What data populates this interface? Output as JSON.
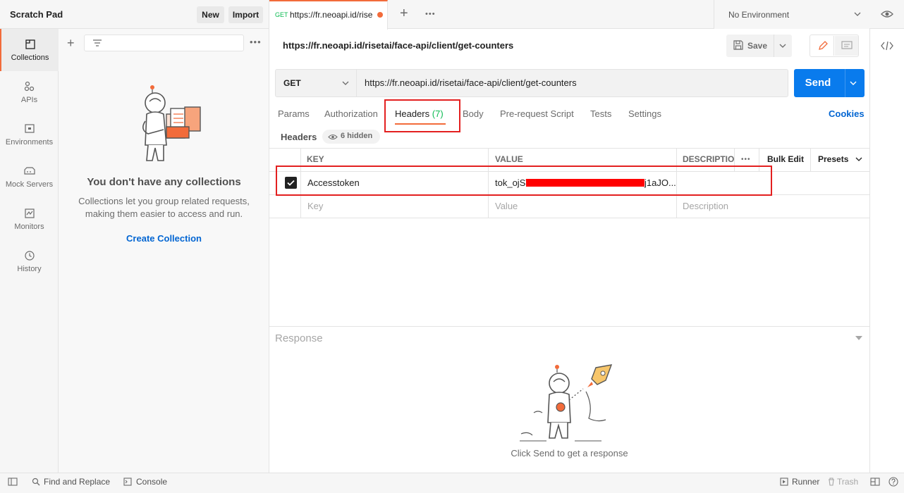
{
  "sidebar": {
    "title": "Scratch Pad",
    "new_label": "New",
    "import_label": "Import",
    "rail": [
      {
        "label": "Collections",
        "icon": "collections-icon"
      },
      {
        "label": "APIs",
        "icon": "apis-icon"
      },
      {
        "label": "Environments",
        "icon": "environments-icon"
      },
      {
        "label": "Mock Servers",
        "icon": "mock-servers-icon"
      },
      {
        "label": "Monitors",
        "icon": "monitors-icon"
      },
      {
        "label": "History",
        "icon": "history-icon"
      }
    ],
    "empty": {
      "heading": "You don't have any collections",
      "line1": "Collections let you group related requests,",
      "line2": "making them easier to access and run.",
      "cta": "Create Collection"
    }
  },
  "tabs": {
    "active": {
      "method": "GET",
      "label": "https://fr.neoapi.id/rise"
    }
  },
  "env": {
    "selected": "No Environment"
  },
  "request": {
    "name": "https://fr.neoapi.id/risetai/face-api/client/get-counters",
    "save_label": "Save",
    "method": "GET",
    "url": "https://fr.neoapi.id/risetai/face-api/client/get-counters",
    "send_label": "Send",
    "subtabs": {
      "params": "Params",
      "authorization": "Authorization",
      "headers": "Headers",
      "headers_count": "(7)",
      "body": "Body",
      "prerequest": "Pre-request Script",
      "tests": "Tests",
      "settings": "Settings",
      "cookies": "Cookies"
    },
    "headers_label": "Headers",
    "hidden_label": "6 hidden",
    "table": {
      "key_col": "KEY",
      "value_col": "VALUE",
      "desc_col": "DESCRIPTIO",
      "bulk_edit": "Bulk Edit",
      "presets": "Presets",
      "row": {
        "key": "Accesstoken",
        "value_start": "tok_ojSV",
        "value_end": "j1aJO..."
      },
      "placeholder": {
        "key": "Key",
        "value": "Value",
        "desc": "Description"
      }
    }
  },
  "response": {
    "label": "Response",
    "hint": "Click Send to get a response"
  },
  "statusbar": {
    "find_replace": "Find and Replace",
    "console": "Console",
    "runner": "Runner",
    "trash": "Trash"
  },
  "colors": {
    "accent": "#f26b3a",
    "send": "#097bed",
    "link": "#0265d2",
    "highlight": "#e32020",
    "count": "#0cbb52"
  }
}
